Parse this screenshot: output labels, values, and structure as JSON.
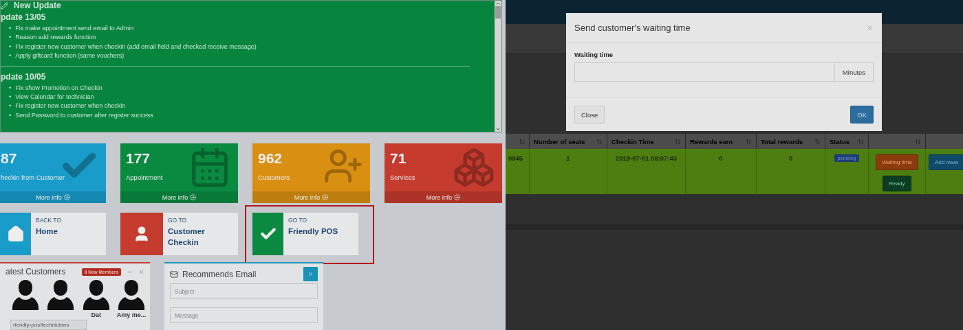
{
  "update_panel": {
    "title": "New Update",
    "bullet": "•",
    "sections": [
      {
        "heading": "pdate 13/05",
        "items": [
          "Fix make appointment send email to Admin",
          "Reason add rewards function",
          "Fix register new customer when checkin (add email field and checked receive message)",
          "Apply giftcard function (same vouchers)"
        ]
      },
      {
        "heading": "pdate 10/05",
        "items": [
          "Fix show Promotion on Checkin",
          "View Calendar for technician",
          "Fix register new customer when checkin",
          "Send Password to customer after register success"
        ]
      }
    ]
  },
  "stat_cards": [
    {
      "value": "87",
      "label": "heckin from Customer",
      "link": "More info",
      "kind": "check",
      "color": "#1a9ccb"
    },
    {
      "value": "177",
      "label": "Appointment",
      "link": "More info",
      "kind": "calendar",
      "color": "#0a8a41"
    },
    {
      "value": "962",
      "label": "Customers",
      "link": "More info",
      "kind": "user-plus",
      "color": "#d98f12"
    },
    {
      "value": "71",
      "label": "Services",
      "link": "More info",
      "kind": "boxes",
      "color": "#c53b2e"
    }
  ],
  "shortcuts": [
    {
      "caption": "BACK TO",
      "title": "Home",
      "kind": "home",
      "color": "#1a9ccb",
      "highlighted": false
    },
    {
      "caption": "GO TO",
      "title": "Customer Checkin",
      "kind": "user",
      "color": "#c53b2e",
      "highlighted": false
    },
    {
      "caption": "GO TO",
      "title": "Friendly POS",
      "kind": "check",
      "color": "#0a8a41",
      "highlighted": true
    }
  ],
  "latest_customers": {
    "title": "atest Customers",
    "badge": "8 New Members",
    "members": [
      {
        "kind": "unnamed"
      },
      {
        "kind": "unnamed"
      },
      {
        "kind": "named",
        "name": "Dat"
      },
      {
        "kind": "named",
        "name": "Amy me..."
      }
    ],
    "status_url": "riendly-pos/technicians"
  },
  "recommends_email": {
    "title": "Recommends Email",
    "fields": [
      {
        "placeholder": "Subject"
      },
      {
        "placeholder": "Message"
      }
    ]
  },
  "table": {
    "columns": [
      "",
      "Number of seats",
      "Checkin Time",
      "Rewards earn",
      "Total rewards",
      "Status",
      "",
      ""
    ],
    "rows": [
      {
        "cells": [
          "0845",
          "1",
          "2019-07-01 08:07:43",
          "0",
          "0"
        ],
        "status": "pending",
        "actions": [
          {
            "label": "Waiting time",
            "kind": "warning"
          },
          {
            "label": "Ready",
            "kind": "success"
          }
        ],
        "extra_action": "Add rewa"
      }
    ]
  },
  "modal": {
    "title": "Send customer's waiting time",
    "field_label": "Waiting time",
    "addon": "Minutes",
    "buttons": [
      {
        "label": "Close",
        "kind": "default"
      },
      {
        "label": "OK",
        "kind": "primary"
      }
    ]
  }
}
